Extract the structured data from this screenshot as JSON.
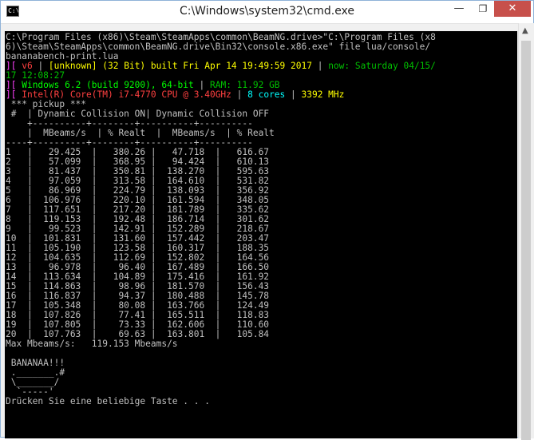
{
  "window": {
    "title": "C:\\Windows\\system32\\cmd.exe",
    "icon_text": "C:\\",
    "minimize": "—",
    "maximize": "❐",
    "close": "✕"
  },
  "console": {
    "cmd_line1": "C:\\Program Files (x86)\\Steam\\SteamApps\\common\\BeamNG.drive>\"C:\\Program Files (x8",
    "cmd_line2": "6)\\Steam\\SteamApps\\common\\BeamNG.drive\\Bin32\\console.x86.exe\" file lua/console/",
    "cmd_line3": "bananabench-print.lua",
    "info1": {
      "bracket": "][ ",
      "version": "v6",
      "sep1": " | ",
      "build_type": "[unknown] (32 Bit) built Fri Apr 14 19:49:59 2017",
      "sep2": " | ",
      "now_label": "now: Saturday 04/15/",
      "now_cont": "17 12:08:27"
    },
    "info2": {
      "bracket": "][ ",
      "os": "Windows 6.2 (build 9200), 64-bit",
      "sep": " | ",
      "ram": "RAM: 11.92 GB"
    },
    "info3": {
      "bracket": "][ ",
      "cpu": "Intel(R) Core(TM) i7-4770 CPU @ 3.40GHz",
      "sep1": " | ",
      "cores": "8 cores",
      "sep2": " | ",
      "mhz": "3392 MHz"
    },
    "section_title": " *** pickup ***",
    "table_header1": " #  | Dynamic Collision ON| Dynamic Collision OFF",
    "table_divider1": "    +----------+--------+----------+----------",
    "table_header2": "    |  MBeams/s  | % Realt  |  MBeams/s  | % Realt",
    "table_divider2": "----+----------+--------+----------+----------",
    "rows": [
      "1   |   29.425  |   380.26 |   47.718  |   616.67",
      "2   |   57.099  |   368.95 |   94.424  |   610.13",
      "3   |   81.437  |   350.81 |  138.270  |   595.63",
      "4   |   97.059  |   313.58 |  164.610  |   531.82",
      "5   |   86.969  |   224.79 |  138.093  |   356.92",
      "6   |  106.976  |   220.10 |  161.594  |   348.05",
      "7   |  117.651  |   217.20 |  181.789  |   335.62",
      "8   |  119.153  |   192.48 |  186.714  |   301.62",
      "9   |   99.523  |   142.91 |  152.289  |   218.67",
      "10  |  101.831  |   131.60 |  157.442  |   203.47",
      "11  |  105.190  |   123.58 |  160.317  |   188.35",
      "12  |  104.635  |   112.69 |  152.802  |   164.56",
      "13  |   96.978  |    96.40 |  167.489  |   166.50",
      "14  |  113.634  |   104.89 |  175.416  |   161.92",
      "15  |  114.863  |    98.96 |  181.570  |   156.43",
      "16  |  116.837  |    94.37 |  180.488  |   145.78",
      "17  |  105.348  |    80.08 |  163.766  |   124.49",
      "18  |  107.826  |    77.41 |  165.511  |   118.83",
      "19  |  107.805  |    73.33 |  162.606  |   110.60",
      "20  |  107.763  |    69.63 |  163.801  |   105.84"
    ],
    "max_line": "Max Mbeams/s:   119.153 Mbeams/s",
    "banana_title": " BANANAA!!!",
    "art1": " ._______.#",
    "art2": " \\_______/",
    "art3": "  `-----'",
    "prompt": "Drücken Sie eine beliebige Taste . . ."
  },
  "colors": {
    "console_bg": "#000000",
    "text_default": "#c0c0c0",
    "green": "#00c000",
    "bright_green": "#00ff00",
    "yellow": "#ffff00",
    "red": "#ff4040",
    "cyan": "#00ffff",
    "close_button": "#c7504b"
  }
}
